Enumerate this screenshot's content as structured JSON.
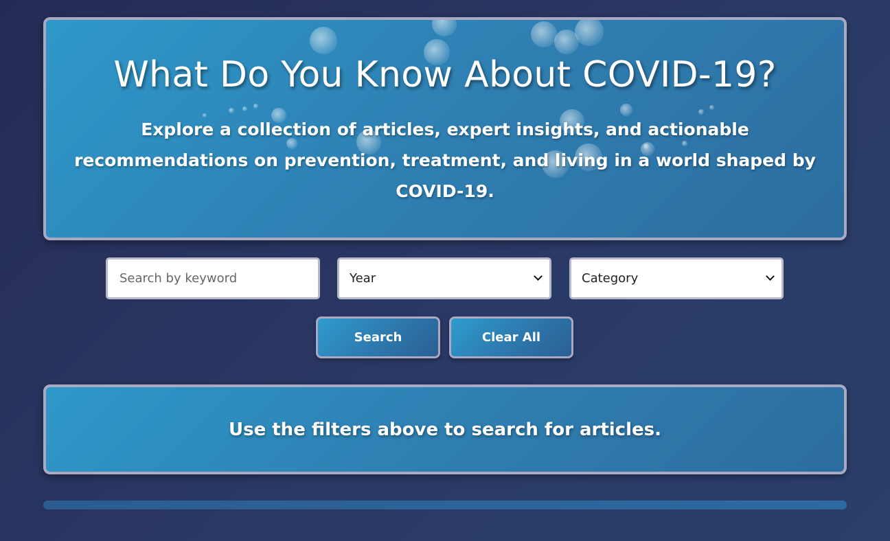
{
  "hero": {
    "title": "What Do You Know About COVID-19?",
    "subtitle": "Explore a collection of articles, expert insights, and actionable recommendations on prevention, treatment, and living in a world shaped by COVID-19."
  },
  "filters": {
    "search_placeholder": "Search by keyword",
    "search_value": "",
    "year_selected": "Year",
    "category_selected": "Category"
  },
  "buttons": {
    "search_label": "Search",
    "clear_label": "Clear All"
  },
  "results": {
    "message": "Use the filters above to search for articles."
  },
  "colors": {
    "page_background": "#262b55",
    "panel_blue": "#2f7fb2",
    "panel_border": "#a9a9c3",
    "text": "#ffffff"
  }
}
